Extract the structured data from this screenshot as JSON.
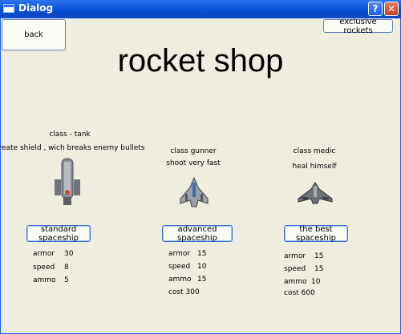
{
  "window": {
    "title": "Dialog"
  },
  "buttons": {
    "back": "back",
    "exclusive": "exclusive rockets"
  },
  "heading": "rocket shop",
  "ships": [
    {
      "class_line": "class - tank",
      "desc": "create shield , wich breaks enemy bullets",
      "button": "standard spaceship",
      "stats": {
        "armor_label": "armor",
        "armor": "30",
        "speed_label": "speed",
        "speed": "8",
        "ammo_label": "ammo",
        "ammo": "5"
      },
      "cost": ""
    },
    {
      "class_line": "class gunner",
      "desc": "shoot very fast",
      "button": "advanced spaceship",
      "stats": {
        "armor_label": "armor",
        "armor": "15",
        "speed_label": "speed",
        "speed": "10",
        "ammo_label": "ammo",
        "ammo": "15"
      },
      "cost": "cost 300"
    },
    {
      "class_line": "class medic",
      "desc": "heal himself",
      "button": "the best spaceship",
      "stats": {
        "armor_label": "armor",
        "armor": "15",
        "speed_label": "speed",
        "speed": "15",
        "ammo_label": "ammo",
        "ammo": "10"
      },
      "cost": "cost 600"
    }
  ]
}
